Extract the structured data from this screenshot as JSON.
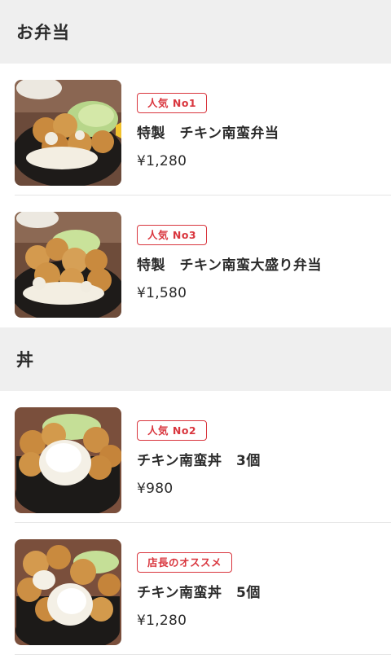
{
  "sections": [
    {
      "title": "お弁当",
      "items": [
        {
          "badge": "人気 No1",
          "name": "特製　チキン南蛮弁当",
          "price": "¥1,280",
          "image": "chicken-nanban-bento-photo"
        },
        {
          "badge": "人気 No3",
          "name": "特製　チキン南蛮大盛り弁当",
          "price": "¥1,580",
          "image": "chicken-nanban-large-bento-photo"
        }
      ]
    },
    {
      "title": "丼",
      "items": [
        {
          "badge": "人気 No2",
          "name": "チキン南蛮丼　3個",
          "price": "¥980",
          "image": "chicken-nanban-don-3-photo"
        },
        {
          "badge": "店長のオススメ",
          "name": "チキン南蛮丼　5個",
          "price": "¥1,280",
          "image": "chicken-nanban-don-5-photo"
        }
      ]
    }
  ],
  "colors": {
    "badge": "#d9363e",
    "section_bg": "#efefef",
    "text": "#2b2b2b",
    "divider": "#e6e6e6"
  }
}
